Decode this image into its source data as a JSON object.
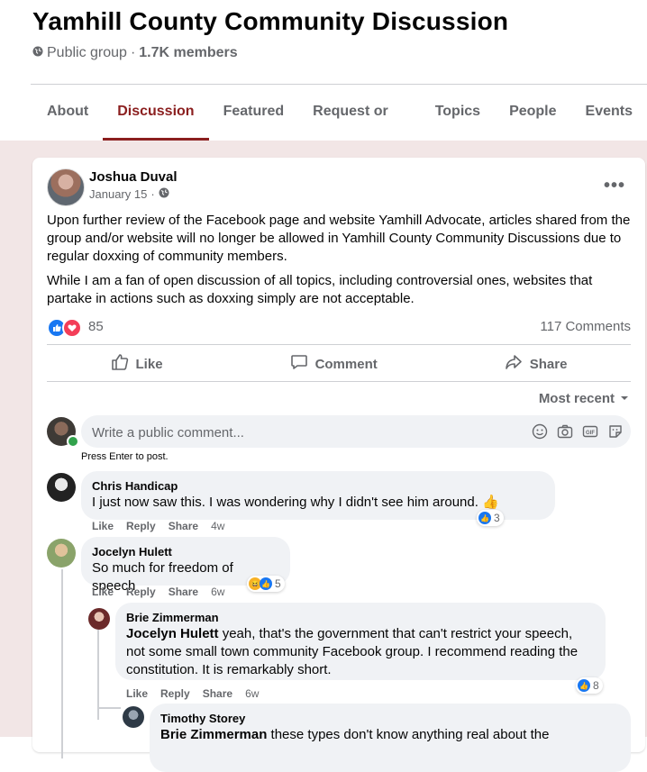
{
  "group": {
    "title": "Yamhill County Community Discussion",
    "privacy": "Public group",
    "separator": "·",
    "members": "1.7K members"
  },
  "tabs": [
    {
      "label": "About"
    },
    {
      "label": "Discussion",
      "active": true
    },
    {
      "label": "Featured"
    },
    {
      "label": "Request or Offer Help"
    },
    {
      "label": "Topics"
    },
    {
      "label": "People"
    },
    {
      "label": "Events"
    }
  ],
  "post": {
    "author": "Joshua Duval",
    "date": "January 15",
    "date_sep": "·",
    "more": "•••",
    "paragraphs": [
      "Upon further review of the Facebook page and website Yamhill Advocate, articles shared from the group and/or website will no longer be allowed in Yamhill County Community Discussions due to regular doxxing of community members.",
      "While I am a fan of open discussion of all topics, including controversial ones, websites that partake in actions such as doxxing simply are not acceptable."
    ],
    "reactions_count": "85",
    "comments_count": "117 Comments",
    "actions": {
      "like": "Like",
      "comment": "Comment",
      "share": "Share"
    },
    "sort_label": "Most recent"
  },
  "composer": {
    "placeholder": "Write a public comment...",
    "hint": "Press Enter to post.",
    "icons": [
      "emoji-icon",
      "camera-icon",
      "gif-icon",
      "sticker-icon"
    ]
  },
  "comment_actions": {
    "like": "Like",
    "reply": "Reply",
    "share": "Share"
  },
  "comments": [
    {
      "name": "Chris Handicap",
      "text": "I just now saw this. I was wondering why I didn't see him around. 👍",
      "time": "4w",
      "reactions": "3"
    },
    {
      "name": "Jocelyn Hulett",
      "text": "So much for freedom of speech",
      "time": "6w",
      "reactions": "5"
    },
    {
      "name": "Brie Zimmerman",
      "mention": "Jocelyn Hulett",
      "text": " yeah, that's the government that can't restrict your speech, not some small town community Facebook group. I recommend reading the constitution. It is remarkably short.",
      "time": "6w",
      "reactions": "8"
    },
    {
      "name": "Timothy Storey",
      "mention": "Brie Zimmerman",
      "text": " these types don't know anything real about the"
    }
  ],
  "colors": {
    "accent": "#8b1f1f",
    "page_bg": "#f2e6e6",
    "bubble_bg": "#f0f2f5",
    "like_blue": "#1877f2",
    "love_red": "#f33e58"
  }
}
